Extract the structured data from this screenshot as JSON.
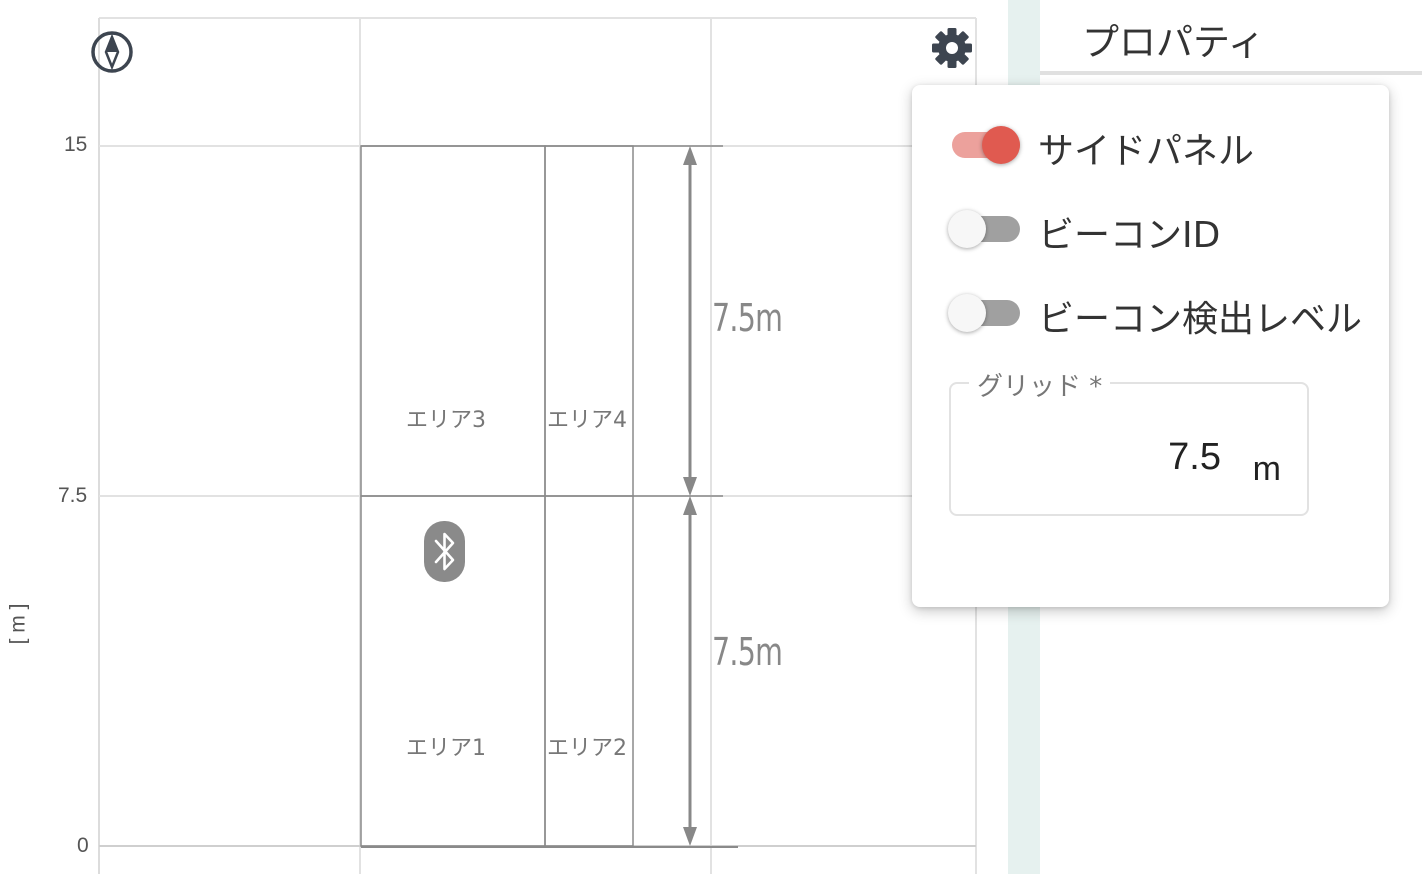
{
  "floor_plan": {
    "y_ticks": [
      "15",
      "7.5",
      "0"
    ],
    "y_unit": "[ m ]",
    "areas": [
      {
        "label": "エリア3"
      },
      {
        "label": "エリア4"
      },
      {
        "label": "エリア1"
      },
      {
        "label": "エリア2"
      }
    ],
    "dimensions": [
      {
        "label": "7.5m"
      },
      {
        "label": "7.5m"
      }
    ],
    "icons": {
      "compass": "compass-icon",
      "settings": "gear-icon",
      "beacon": "bluetooth-icon"
    }
  },
  "side_panel": {
    "title": "プロパティ"
  },
  "settings_popup": {
    "toggles": [
      {
        "label": "サイドパネル",
        "on": true
      },
      {
        "label": "ビーコンID",
        "on": false
      },
      {
        "label": "ビーコン検出レベル",
        "on": false
      }
    ],
    "grid_field": {
      "legend": "グリッド *",
      "value": "7.5",
      "unit": "m"
    }
  },
  "colors": {
    "accent": "#e05a50",
    "accent_track": "#eca19c",
    "splitter": "#e6f1ef",
    "beacon": "#8a8a8a"
  }
}
